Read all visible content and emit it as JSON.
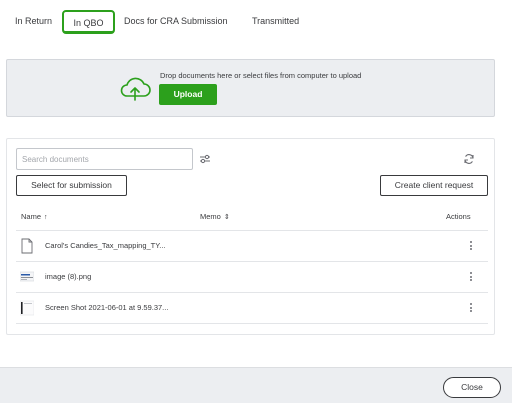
{
  "tabs": [
    {
      "label": "In Return"
    },
    {
      "label": "In QBO",
      "active": true
    },
    {
      "label": "Docs for CRA Submission"
    },
    {
      "label": "Transmitted"
    }
  ],
  "upload": {
    "instruction": "Drop documents here or select files from computer to upload",
    "button_label": "Upload",
    "icon": "cloud-upload-icon"
  },
  "documents": {
    "search_placeholder": "Search documents",
    "select_button": "Select for submission",
    "request_button": "Create client request",
    "columns": {
      "name": "Name",
      "name_sort": "↑",
      "memo": "Memo",
      "memo_sort": "⇕",
      "actions": "Actions"
    },
    "rows": [
      {
        "name": "Carol's Candies_Tax_mapping_TY...",
        "memo": "",
        "icon": "document-icon"
      },
      {
        "name": "image (8).png",
        "memo": "",
        "icon": "image-thumbnail-icon"
      },
      {
        "name": "Screen Shot 2021-06-01 at 9.59.37...",
        "memo": "",
        "icon": "screenshot-thumbnail-icon"
      }
    ]
  },
  "footer": {
    "close_label": "Close"
  },
  "colors": {
    "accent": "#2ca01c",
    "panel": "#eceef1",
    "text": "#393a3d"
  }
}
